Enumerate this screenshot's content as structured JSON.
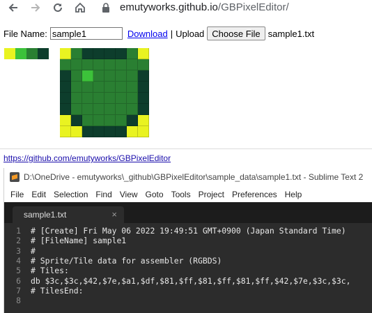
{
  "browser": {
    "url_host": "emutyworks.github.io",
    "url_path": "/GBPixelEditor/"
  },
  "controls": {
    "file_name_label": "File Name:",
    "file_name_value": "sample1",
    "download_label": "Download",
    "separator": "|",
    "upload_label": "Upload",
    "choose_file_label": "Choose File",
    "chosen_file": "sample1.txt"
  },
  "palette": [
    "#e9f321",
    "#3cc23a",
    "#2a7f32",
    "#0d3d2c"
  ],
  "pixels": [
    [
      0,
      2,
      3,
      3,
      3,
      3,
      2,
      0
    ],
    [
      2,
      2,
      2,
      2,
      2,
      2,
      2,
      2
    ],
    [
      3,
      2,
      1,
      2,
      2,
      2,
      2,
      3
    ],
    [
      3,
      2,
      2,
      2,
      2,
      2,
      2,
      3
    ],
    [
      3,
      2,
      2,
      2,
      2,
      2,
      2,
      3
    ],
    [
      3,
      2,
      2,
      2,
      2,
      2,
      2,
      3
    ],
    [
      0,
      3,
      2,
      2,
      2,
      2,
      3,
      0
    ],
    [
      0,
      0,
      3,
      3,
      3,
      3,
      0,
      0
    ]
  ],
  "github_link": "https://github.com/emutyworks/GBPixelEditor",
  "sublime": {
    "title": "D:\\OneDrive - emutyworks\\_github\\GBPixelEditor\\sample_data\\sample1.txt - Sublime Text 2",
    "menu": [
      "File",
      "Edit",
      "Selection",
      "Find",
      "View",
      "Goto",
      "Tools",
      "Project",
      "Preferences",
      "Help"
    ],
    "tab_label": "sample1.txt",
    "tab_close": "×",
    "lines": [
      {
        "n": "1",
        "text": "# [Create] Fri May 06 2022 19:49:51 GMT+0900 (Japan Standard Time)"
      },
      {
        "n": "2",
        "text": "# [FileName] sample1"
      },
      {
        "n": "3",
        "text": "#"
      },
      {
        "n": "4",
        "text": "# Sprite/Tile data for assembler (RGBDS)"
      },
      {
        "n": "5",
        "text": "# Tiles:"
      },
      {
        "n": "6",
        "text": "db $3c,$3c,$42,$7e,$a1,$df,$81,$ff,$81,$ff,$81,$ff,$42,$7e,$3c,$3c,"
      },
      {
        "n": "7",
        "text": "# TilesEnd:"
      },
      {
        "n": "8",
        "text": ""
      }
    ]
  }
}
